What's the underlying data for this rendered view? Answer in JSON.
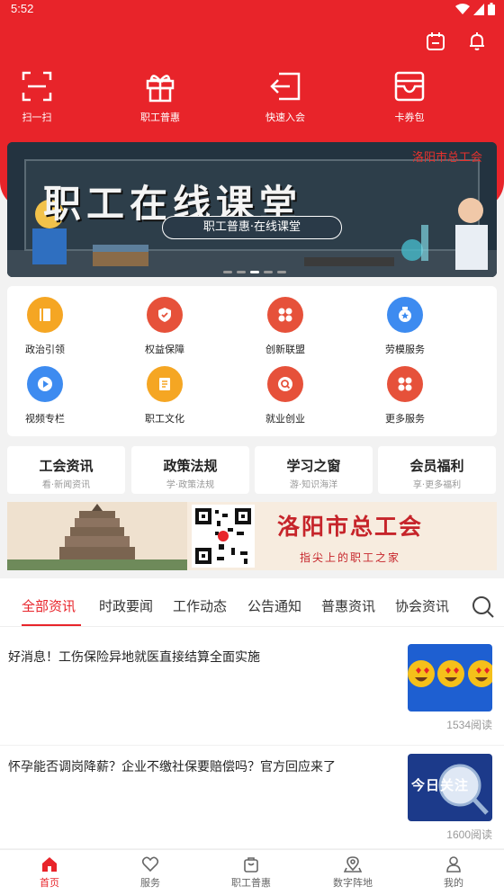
{
  "status_bar": {
    "time": "5:52"
  },
  "quick_actions": [
    {
      "label": "扫一扫",
      "icon": "scan-icon"
    },
    {
      "label": "职工普惠",
      "icon": "gift-icon"
    },
    {
      "label": "快速入会",
      "icon": "login-icon"
    },
    {
      "label": "卡券包",
      "icon": "wallet-icon"
    }
  ],
  "banner": {
    "title": "职工在线课堂",
    "subtitle": "职工普惠·在线课堂",
    "brand_text": "洛阳市总工会"
  },
  "services": [
    {
      "label": "政治引领",
      "icon": "book-icon",
      "color": "#f5a623"
    },
    {
      "label": "权益保障",
      "icon": "shield-icon",
      "color": "#e6513a"
    },
    {
      "label": "创新联盟",
      "icon": "grid-icon",
      "color": "#e6513a"
    },
    {
      "label": "劳模服务",
      "icon": "medal-icon",
      "color": "#3d8bf0"
    },
    {
      "label": "视频专栏",
      "icon": "play-icon",
      "color": "#3d8bf0"
    },
    {
      "label": "职工文化",
      "icon": "document-icon",
      "color": "#f5a623"
    },
    {
      "label": "就业创业",
      "icon": "search-badge-icon",
      "color": "#e6513a"
    },
    {
      "label": "更多服务",
      "icon": "more-grid-icon",
      "color": "#e6513a"
    }
  ],
  "info_cards": [
    {
      "title": "工会资讯",
      "subtitle": "看·新闻资讯"
    },
    {
      "title": "政策法规",
      "subtitle": "学·政策法规"
    },
    {
      "title": "学习之窗",
      "subtitle": "游·知识海洋"
    },
    {
      "title": "会员福利",
      "subtitle": "享·更多福利"
    }
  ],
  "promo": {
    "city": "洛阳市总工会",
    "slogan": "指尖上的职工之家"
  },
  "news_tabs": [
    "全部资讯",
    "时政要闻",
    "工作动态",
    "公告通知",
    "普惠资讯",
    "协会资讯"
  ],
  "news": [
    {
      "headline": "好消息！工伤保险异地就医直接结算全面实施",
      "reads": "1534阅读"
    },
    {
      "headline": "怀孕能否调岗降薪？企业不缴社保要赔偿吗？官方回应来了",
      "reads": "1600阅读",
      "thumb_text": "今日关注"
    }
  ],
  "bottom_nav": [
    {
      "label": "首页",
      "icon": "home-icon",
      "active": true
    },
    {
      "label": "服务",
      "icon": "heart-icon"
    },
    {
      "label": "职工普惠",
      "icon": "bag-icon"
    },
    {
      "label": "数字阵地",
      "icon": "location-icon"
    },
    {
      "label": "我的",
      "icon": "user-icon"
    }
  ],
  "colors": {
    "brand_red": "#e8242a"
  }
}
